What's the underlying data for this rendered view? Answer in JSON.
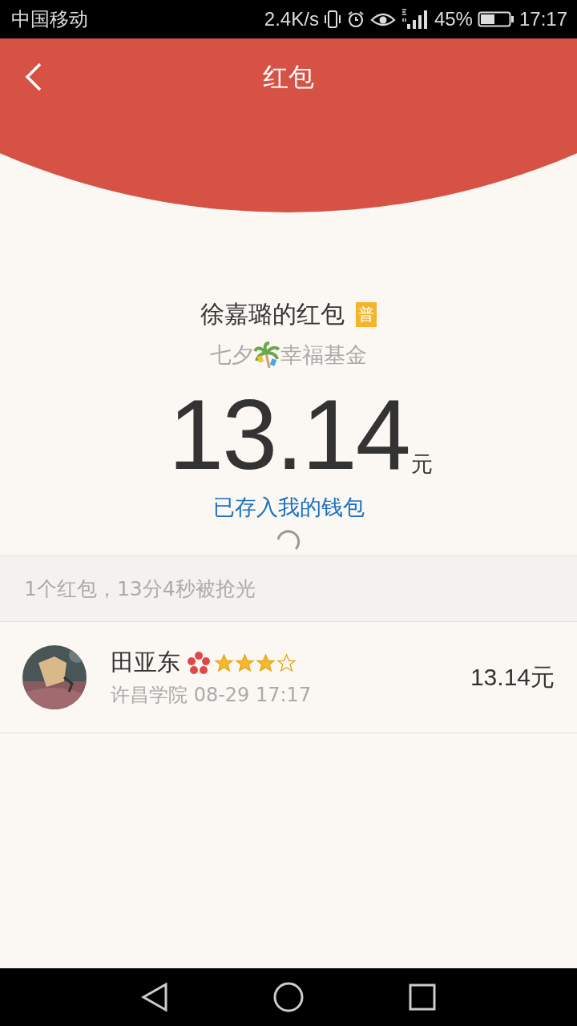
{
  "status_bar": {
    "carrier": "中国移动",
    "speed": "2.4K/s",
    "battery": "45%",
    "time": "17:17"
  },
  "header": {
    "title": "红包"
  },
  "packet": {
    "sender_title": "徐嘉璐的红包",
    "badge": "普",
    "greeting_before": "七夕",
    "greeting_after": "幸福基金",
    "amount": "13.14",
    "unit": "元",
    "wallet_link": "已存入我的钱包"
  },
  "summary": "1个红包，13分4秒被抢光",
  "recipients": [
    {
      "name": "田亚东",
      "stars": 3,
      "school_time": "许昌学院 08-29 17:17",
      "amount": "13.14元"
    }
  ]
}
